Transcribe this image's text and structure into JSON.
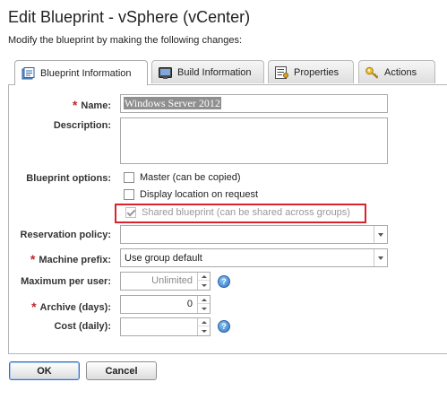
{
  "page": {
    "title": "Edit Blueprint - vSphere (vCenter)",
    "subtitle": "Modify the blueprint by making the following changes:"
  },
  "tabs": [
    {
      "label": "Blueprint Information",
      "icon": "blueprint-info-icon",
      "active": true
    },
    {
      "label": "Build Information",
      "icon": "build-info-icon",
      "active": false
    },
    {
      "label": "Properties",
      "icon": "properties-icon",
      "active": false
    },
    {
      "label": "Actions",
      "icon": "actions-key-icon",
      "active": false
    }
  ],
  "form": {
    "name_label": "Name:",
    "name_value": "Windows Server 2012",
    "description_label": "Description:",
    "description_value": "",
    "options_label": "Blueprint options:",
    "options": [
      {
        "label": "Master (can be copied)",
        "checked": false,
        "disabled": false
      },
      {
        "label": "Display location on request",
        "checked": false,
        "disabled": false
      },
      {
        "label": "Shared blueprint (can be shared across groups)",
        "checked": true,
        "disabled": true
      }
    ],
    "reservation_policy_label": "Reservation policy:",
    "reservation_policy_value": "",
    "machine_prefix_label": "Machine prefix:",
    "machine_prefix_value": "Use group default",
    "max_per_user_label": "Maximum per user:",
    "max_per_user_value": "Unlimited",
    "archive_label": "Archive (days):",
    "archive_value": "0",
    "cost_label": "Cost (daily):",
    "cost_value": "",
    "required_marker": "*",
    "help_glyph": "?"
  },
  "buttons": {
    "ok": "OK",
    "cancel": "Cancel"
  },
  "colors": {
    "required": "#c1272d",
    "highlight": "#d9232e",
    "help": "#2f76c6"
  }
}
